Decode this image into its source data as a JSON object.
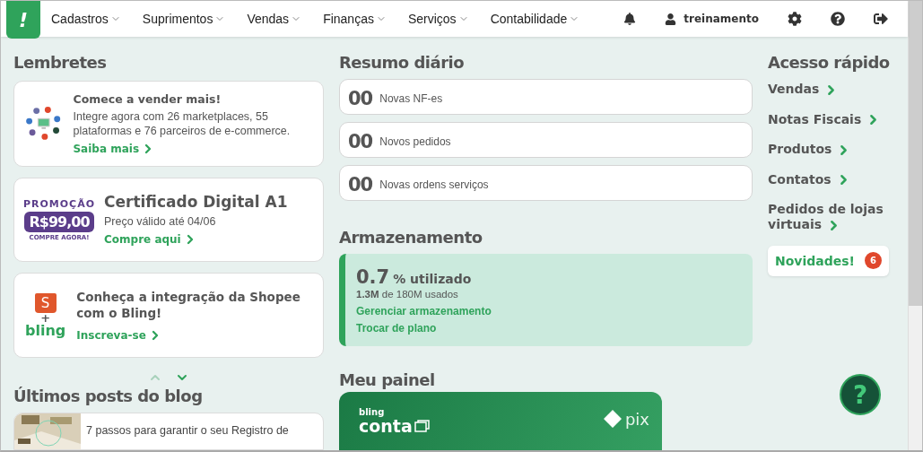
{
  "nav": {
    "logo": "!",
    "menus": [
      {
        "label": "Cadastros"
      },
      {
        "label": "Suprimentos"
      },
      {
        "label": "Vendas"
      },
      {
        "label": "Finanças"
      },
      {
        "label": "Serviços"
      },
      {
        "label": "Contabilidade"
      }
    ],
    "user": "treinamento"
  },
  "reminders": {
    "title": "Lembretes",
    "cards": [
      {
        "kind": "marketplaces",
        "title": "Comece a vender mais!",
        "text": "Integre agora com 26 marketplaces, 55 plataformas e 76 parceiros de e-commerce.",
        "link": "Saiba mais"
      },
      {
        "kind": "promo",
        "promo_label": "PROMOÇÃO",
        "price": "R$99,00",
        "promo_cta": "COMPRE AGORA!",
        "title": "Certificado Digital A1",
        "subtitle": "Preço válido até 04/06",
        "link": "Compre aqui"
      },
      {
        "kind": "shopee",
        "bag_mark": "S",
        "plus": "+",
        "brand": "bling",
        "title": "Conheça a integração da Shopee com o Bling!",
        "link": "Inscreva-se"
      }
    ],
    "prev_disabled": true,
    "next_disabled": false
  },
  "blog": {
    "title": "Últimos posts do blog",
    "posts": [
      {
        "title": "7 passos para garantir o seu Registro de"
      }
    ]
  },
  "summary": {
    "title": "Resumo diário",
    "items": [
      {
        "count": "00",
        "label": "Novas NF-es"
      },
      {
        "count": "00",
        "label": "Novos pedidos"
      },
      {
        "count": "00",
        "label": "Novas ordens serviços"
      }
    ]
  },
  "storage": {
    "title": "Armazenamento",
    "percent": "0.7",
    "unit": "% utilizado",
    "used": "1.3M",
    "used_text": "de 180M usados",
    "links": [
      "Gerenciar armazenamento",
      "Trocar de plano"
    ]
  },
  "panel": {
    "title": "Meu painel",
    "brand_small": "bling",
    "brand": "conta",
    "partner": "pix"
  },
  "quick_access": {
    "title": "Acesso rápido",
    "links": [
      "Vendas",
      "Notas Fiscais",
      "Produtos",
      "Contatos",
      "Pedidos de lojas virtuais"
    ],
    "news": {
      "label": "Novidades!",
      "count": "6"
    }
  },
  "help": "?"
}
